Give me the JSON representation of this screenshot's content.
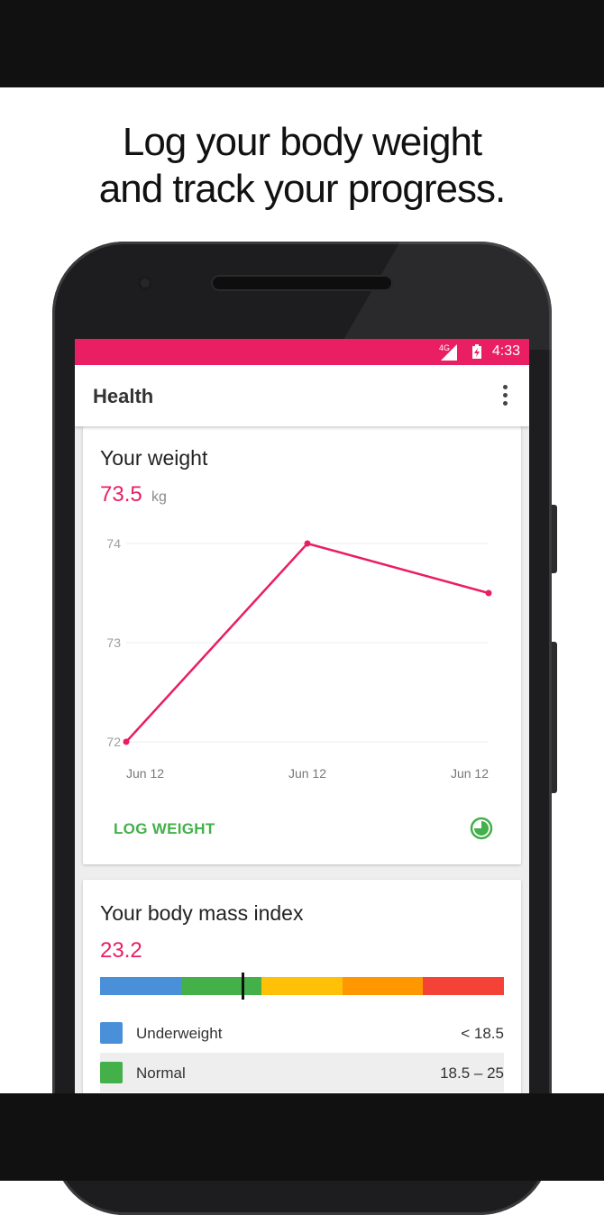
{
  "headline": {
    "line1": "Log your body weight",
    "line2": "and track your progress."
  },
  "status_bar": {
    "network": "4G",
    "time": "4:33"
  },
  "app_bar": {
    "title": "Health",
    "menu_icon": "more-vert-icon"
  },
  "weight_card": {
    "title": "Your weight",
    "value": "73.5",
    "unit": "kg",
    "log_button": "LOG WEIGHT",
    "history_icon": "history-clock-icon"
  },
  "chart_data": {
    "type": "line",
    "categories": [
      "Jun 12",
      "Jun 12",
      "Jun 12"
    ],
    "series": [
      {
        "values": [
          72,
          74,
          73.5
        ]
      }
    ],
    "ylim": [
      72,
      74
    ],
    "yticks": [
      "74",
      "73",
      "72"
    ],
    "grid": true,
    "color": "#e91e63"
  },
  "bmi_card": {
    "title": "Your body mass index",
    "value": "23.2",
    "scale_colors": [
      "#4a90d9",
      "#43b04a",
      "#ffc107",
      "#ff9800",
      "#f44336"
    ],
    "marker_position": 0.353,
    "legend": [
      {
        "label": "Underweight",
        "range": "< 18.5",
        "color": "#4a90d9"
      },
      {
        "label": "Normal",
        "range": "18.5 – 25",
        "color": "#43b04a"
      }
    ]
  },
  "colors": {
    "accent": "#e91e63",
    "action": "#43b04a"
  }
}
